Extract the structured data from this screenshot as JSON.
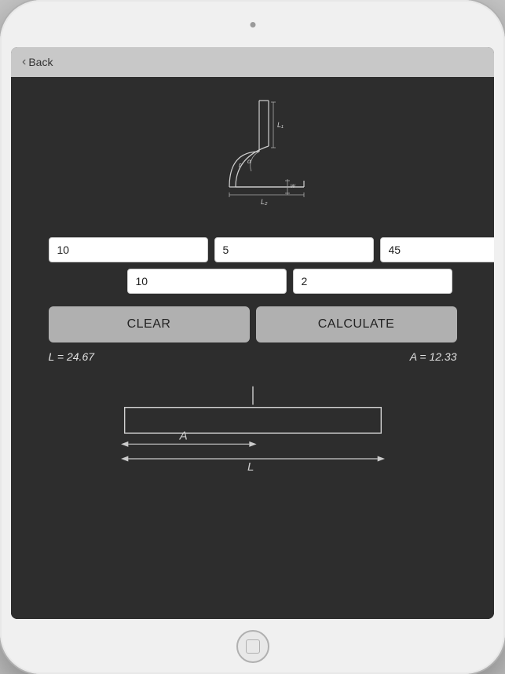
{
  "nav": {
    "back_label": "Back",
    "back_chevron": "‹"
  },
  "inputs": {
    "top_row": [
      {
        "id": "input-d",
        "value": "10",
        "placeholder": ""
      },
      {
        "id": "input-r",
        "value": "5",
        "placeholder": ""
      },
      {
        "id": "input-angle",
        "value": "45",
        "placeholder": ""
      }
    ],
    "bottom_row": [
      {
        "id": "input-t",
        "value": "10",
        "placeholder": ""
      },
      {
        "id": "input-k",
        "value": "2",
        "placeholder": ""
      }
    ]
  },
  "buttons": {
    "clear_label": "CLEAR",
    "calculate_label": "CALCULATE"
  },
  "results": {
    "L_label": "L = 24.67",
    "A_label": "A = 12.33"
  },
  "colors": {
    "background": "#2d2d2d",
    "nav_bar": "#c8c8c8",
    "button_bg": "#b0b0b0",
    "diagram_stroke": "#e0e0e0",
    "text": "#e0e0e0"
  }
}
